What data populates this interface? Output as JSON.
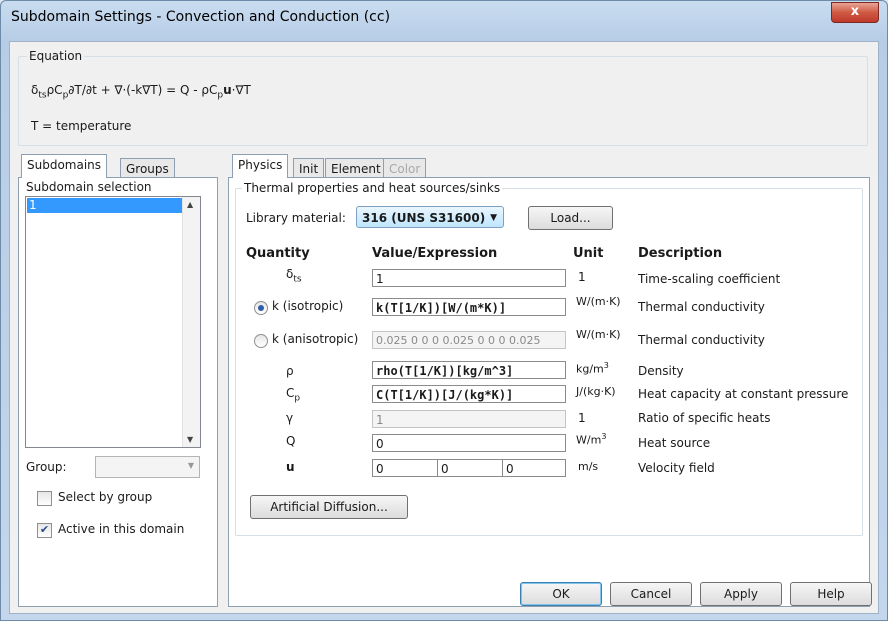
{
  "window": {
    "title": "Subdomain Settings - Convection and Conduction (cc)",
    "close_glyph": "x"
  },
  "equation": {
    "group_label": "Equation",
    "line1": {
      "d": "δ",
      "ts": "ts",
      "rho_c": "ρC",
      "p": "p",
      "mid": "∂T/∂t + ∇·(-k∇T) = Q - ρC",
      "p2": "p",
      "u": "u",
      "end": "·∇T"
    },
    "line2": "T = temperature"
  },
  "left_tabs": {
    "subdomains": "Subdomains",
    "groups": "Groups"
  },
  "subdomain_selection": {
    "label": "Subdomain selection",
    "items": [
      "1"
    ],
    "selected": "1"
  },
  "group": {
    "label": "Group:",
    "value": ""
  },
  "checkboxes": {
    "select_by_group": {
      "label": "Select by group",
      "checked": false
    },
    "active": {
      "label": "Active in this domain",
      "checked": true
    }
  },
  "right_tabs": {
    "physics": "Physics",
    "init": "Init",
    "element": "Element",
    "color": "Color"
  },
  "thermal": {
    "group_label": "Thermal properties and heat sources/sinks",
    "library_label": "Library material:",
    "library_value": "316 (UNS S31600)",
    "load_button": "Load..."
  },
  "table": {
    "headers": {
      "quantity": "Quantity",
      "value": "Value/Expression",
      "unit": "Unit",
      "description": "Description"
    },
    "rows": {
      "dts": {
        "q": "δ",
        "sub": "ts",
        "value": "1",
        "unit": "1",
        "desc": "Time-scaling coefficient"
      },
      "k_iso": {
        "q": "k (isotropic)",
        "value": "k(T[1/K])[W/(m*K)]",
        "unit": "W/(m·K)",
        "desc": "Thermal conductivity",
        "selected": true
      },
      "k_aniso": {
        "q": "k (anisotropic)",
        "value": "0.025 0 0 0 0.025 0 0 0 0.025",
        "unit": "W/(m·K)",
        "desc": "Thermal conductivity",
        "selected": false
      },
      "rho": {
        "q": "ρ",
        "value": "rho(T[1/K])[kg/m^3]",
        "unit": "kg/m",
        "unit_sup": "3",
        "desc": "Density"
      },
      "cp": {
        "q": "C",
        "sub": "p",
        "value": "C(T[1/K])[J/(kg*K)]",
        "unit": "J/(kg·K)",
        "desc": "Heat capacity at constant pressure"
      },
      "gamma": {
        "q": "γ",
        "value": "1",
        "unit": "1",
        "desc": "Ratio of specific heats"
      },
      "Q": {
        "q": "Q",
        "value": "0",
        "unit": "W/m",
        "unit_sup": "3",
        "desc": "Heat source"
      },
      "u": {
        "q": "u",
        "values": [
          "0",
          "0",
          "0"
        ],
        "unit": "m/s",
        "desc": "Velocity field"
      }
    }
  },
  "artificial_diffusion_button": "Artificial Diffusion...",
  "buttons": {
    "ok": "OK",
    "cancel": "Cancel",
    "apply": "Apply",
    "help": "Help"
  },
  "colors": {
    "selection": "#3399ff",
    "title_bg": "#c9dcf0",
    "close": "#c0392b"
  }
}
